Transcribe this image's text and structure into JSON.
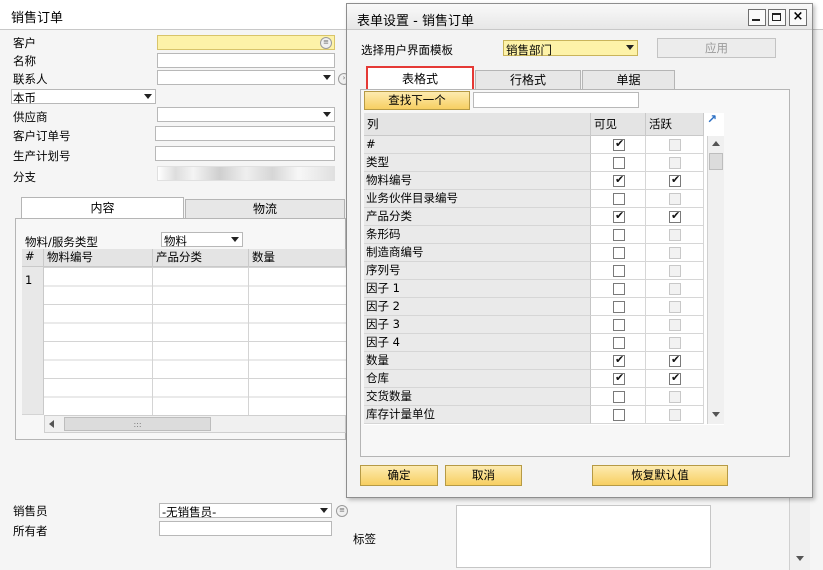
{
  "colors": {
    "highlight_red": "#e53935",
    "button_orange": "#f7cf62",
    "field_yellow": "#fdf2a8"
  },
  "sales_order": {
    "title": "销售订单",
    "labels": {
      "customer": "客户",
      "name": "名称",
      "contact": "联系人",
      "currency": "本币",
      "vendor": "供应商",
      "customer_order_no": "客户订单号",
      "production_plan_no": "生产计划号",
      "branch": "分支"
    },
    "tabs": [
      "内容",
      "物流"
    ],
    "item_type_label": "物料/服务类型",
    "item_type_value": "物料",
    "grid": {
      "headers": [
        "#",
        "物料编号",
        "产品分类",
        "数量"
      ],
      "first_row_no": "1"
    },
    "scroll_grip": ":::",
    "salesperson_label": "销售员",
    "salesperson_value": "-无销售员-",
    "owner_label": "所有者",
    "tags_label": "标签"
  },
  "dialog": {
    "title": "表单设置 - 销售订单",
    "template_label": "选择用户界面模板",
    "template_value": "销售部门",
    "apply_button": "应用",
    "tabs": [
      "表格式",
      "行格式",
      "单据"
    ],
    "find_next_button": "查找下一个",
    "find_input_value": "",
    "columns_header": {
      "col": "列",
      "visible": "可见",
      "active": "活跃"
    },
    "rows": [
      {
        "name": "#",
        "visible": true,
        "visible_enabled": true,
        "active": false,
        "active_enabled": false
      },
      {
        "name": "类型",
        "visible": false,
        "visible_enabled": true,
        "active": false,
        "active_enabled": false
      },
      {
        "name": "物料编号",
        "visible": true,
        "visible_enabled": true,
        "active": true,
        "active_enabled": true
      },
      {
        "name": "业务伙伴目录编号",
        "visible": false,
        "visible_enabled": true,
        "active": false,
        "active_enabled": false
      },
      {
        "name": "产品分类",
        "visible": true,
        "visible_enabled": true,
        "active": true,
        "active_enabled": true
      },
      {
        "name": "条形码",
        "visible": false,
        "visible_enabled": true,
        "active": false,
        "active_enabled": false
      },
      {
        "name": "制造商编号",
        "visible": false,
        "visible_enabled": true,
        "active": false,
        "active_enabled": false
      },
      {
        "name": "序列号",
        "visible": false,
        "visible_enabled": true,
        "active": false,
        "active_enabled": false
      },
      {
        "name": "因子 1",
        "visible": false,
        "visible_enabled": true,
        "active": false,
        "active_enabled": false
      },
      {
        "name": "因子 2",
        "visible": false,
        "visible_enabled": true,
        "active": false,
        "active_enabled": false
      },
      {
        "name": "因子 3",
        "visible": false,
        "visible_enabled": true,
        "active": false,
        "active_enabled": false
      },
      {
        "name": "因子 4",
        "visible": false,
        "visible_enabled": true,
        "active": false,
        "active_enabled": false
      },
      {
        "name": "数量",
        "visible": true,
        "visible_enabled": true,
        "active": true,
        "active_enabled": true
      },
      {
        "name": "仓库",
        "visible": true,
        "visible_enabled": true,
        "active": true,
        "active_enabled": true
      },
      {
        "name": "交货数量",
        "visible": false,
        "visible_enabled": true,
        "active": false,
        "active_enabled": false
      },
      {
        "name": "库存计量单位",
        "visible": false,
        "visible_enabled": true,
        "active": false,
        "active_enabled": false
      }
    ],
    "ok_button": "确定",
    "cancel_button": "取消",
    "restore_default_button": "恢复默认值"
  }
}
